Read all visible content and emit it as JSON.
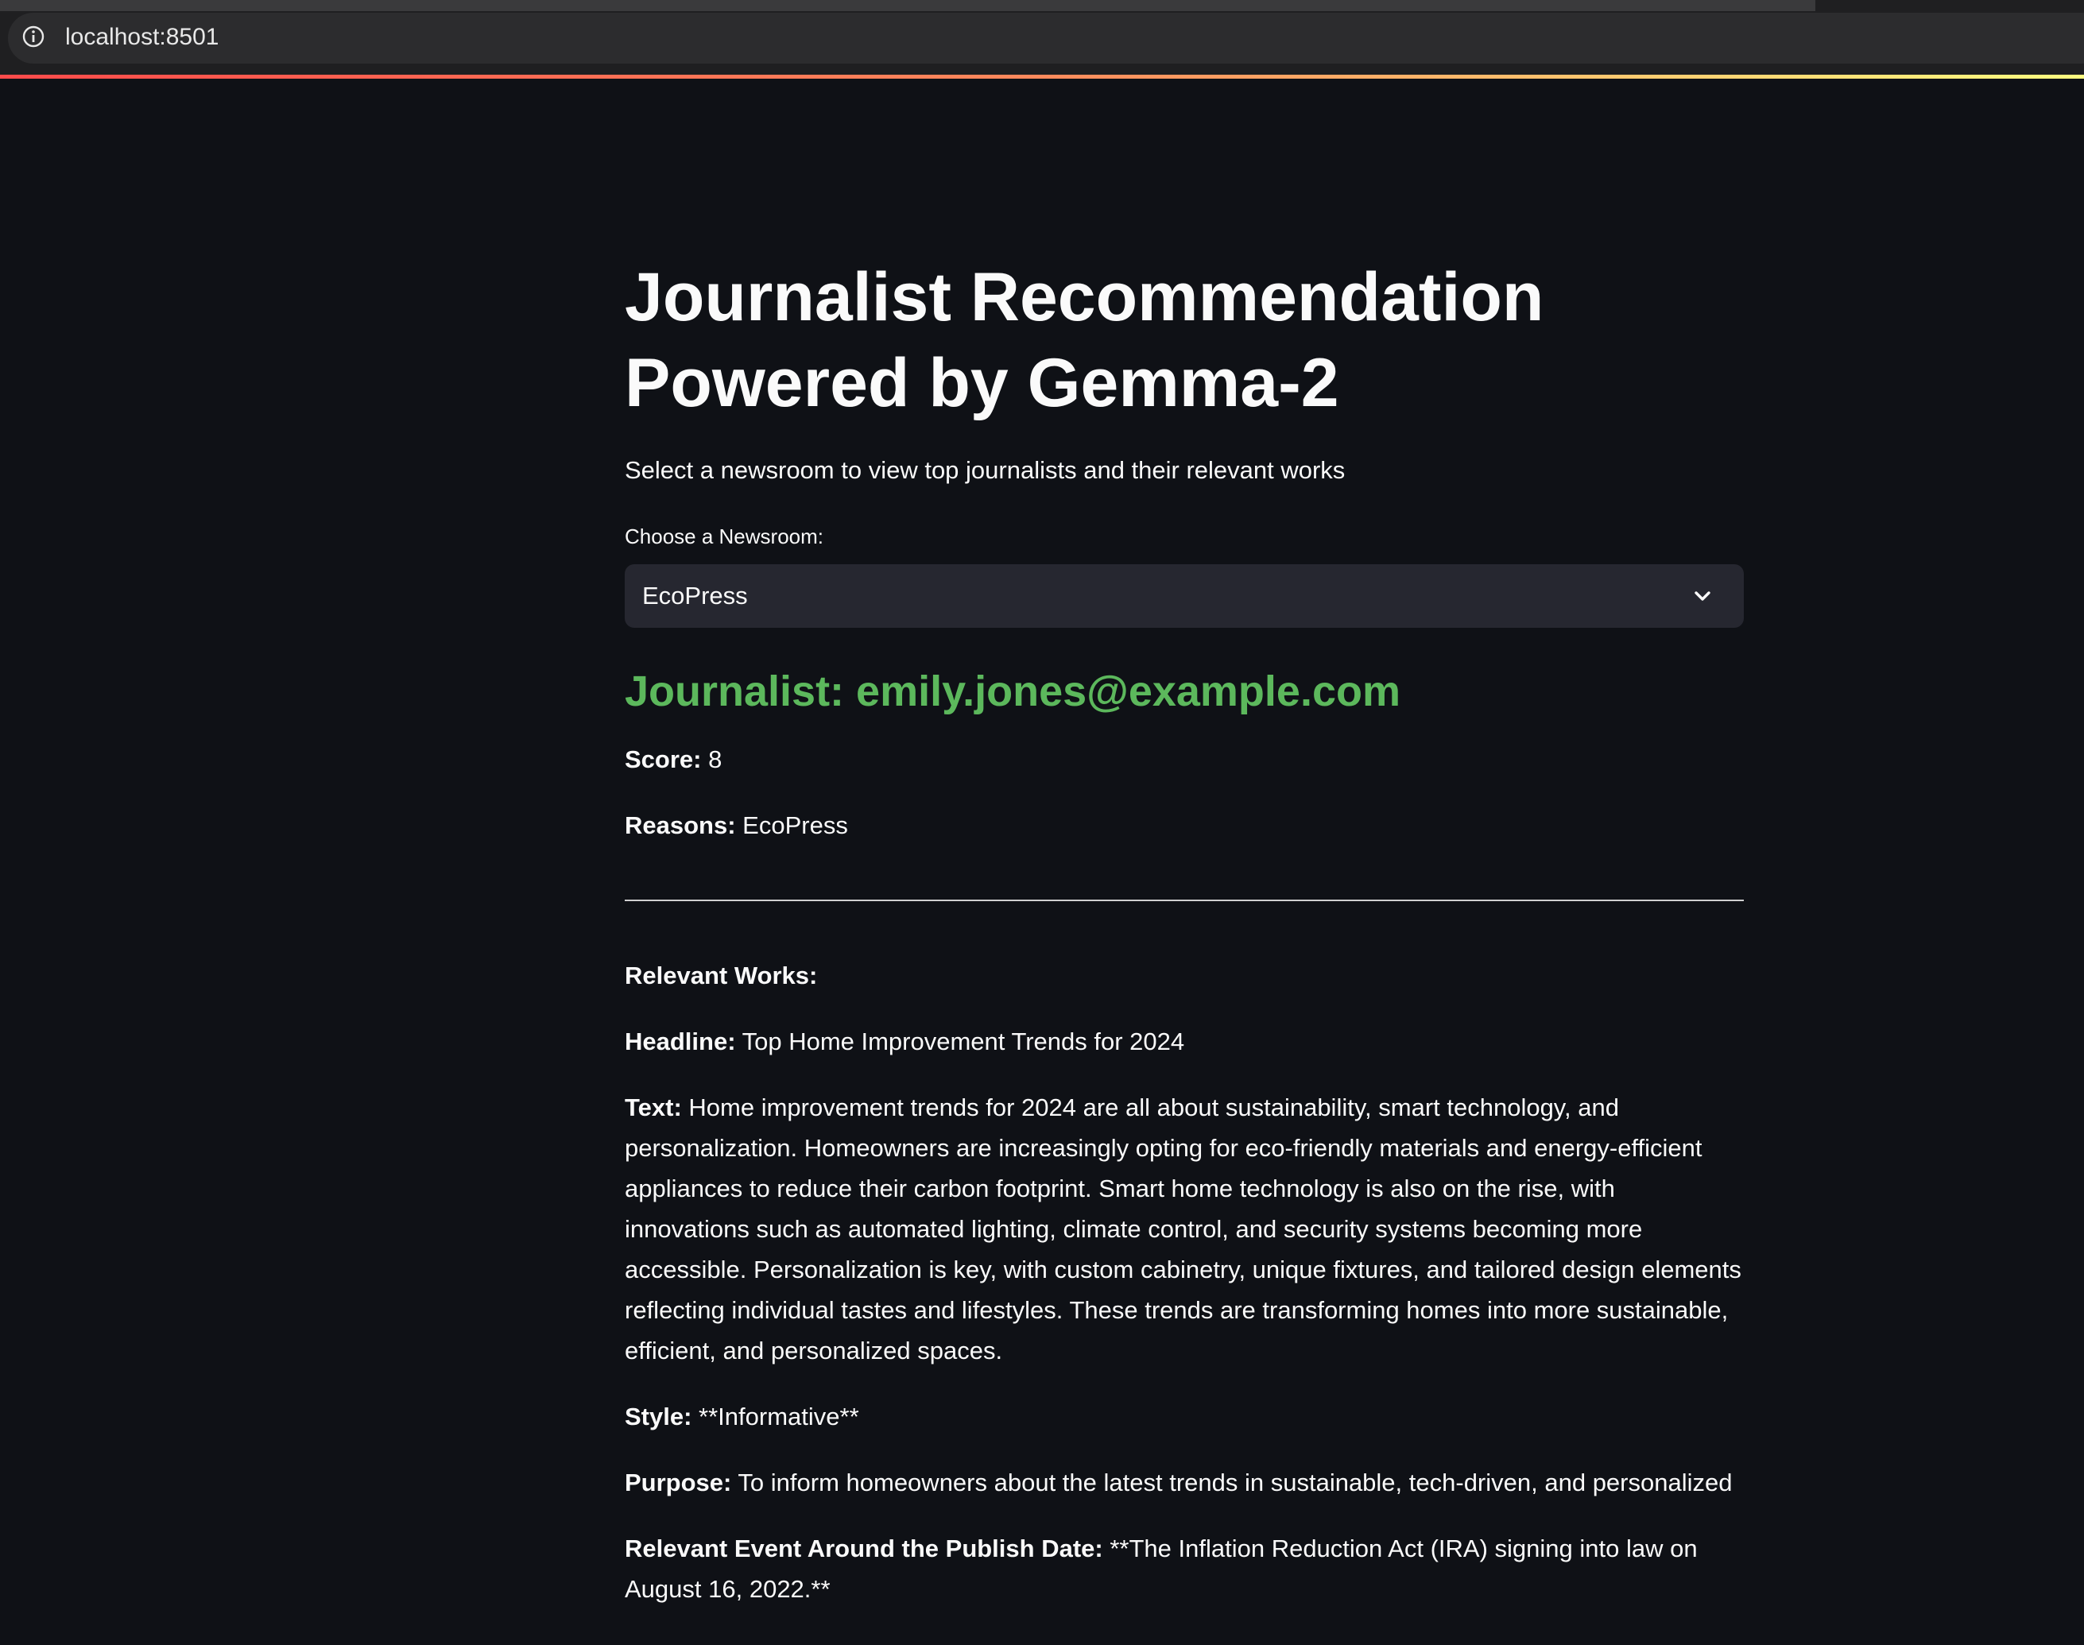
{
  "browser": {
    "url": "localhost:8501"
  },
  "page": {
    "title": "Journalist Recommendation Powered by Gemma-2",
    "subtitle": "Select a newsroom to view top journalists and their relevant works"
  },
  "newsroom_select": {
    "label": "Choose a Newsroom:",
    "selected": "EcoPress"
  },
  "journalist": {
    "heading": "Journalist: emily.jones@example.com",
    "score_label": "Score:",
    "score_value": "8",
    "reasons_label": "Reasons:",
    "reasons_value": "EcoPress"
  },
  "works": {
    "section_label": "Relevant Works:",
    "headline_label": "Headline:",
    "headline_value": "Top Home Improvement Trends for 2024",
    "text_label": "Text:",
    "text_value": "Home improvement trends for 2024 are all about sustainability, smart technology, and personalization. Homeowners are increasingly opting for eco-friendly materials and energy-efficient appliances to reduce their carbon footprint. Smart home technology is also on the rise, with innovations such as automated lighting, climate control, and security systems becoming more accessible. Personalization is key, with custom cabinetry, unique fixtures, and tailored design elements reflecting individual tastes and lifestyles. These trends are transforming homes into more sustainable, efficient, and personalized spaces.",
    "style_label": "Style:",
    "style_value": "**Informative**",
    "purpose_label": "Purpose:",
    "purpose_value": "To inform homeowners about the latest trends in sustainable, tech-driven, and personalized",
    "event_label": "Relevant Event Around the Publish Date:",
    "event_value": "**The Inflation Reduction Act (IRA) signing into law on August 16, 2022.**"
  },
  "colors": {
    "background": "#0f1116",
    "text": "#fafafa",
    "journalist_heading": "#5cb85c",
    "select_background": "#262730",
    "decoration_gradient_start": "#ff4b4b",
    "decoration_gradient_end": "#fffd80"
  },
  "icons": {
    "address_info": "info-icon",
    "select_chevron": "chevron-down-icon"
  }
}
